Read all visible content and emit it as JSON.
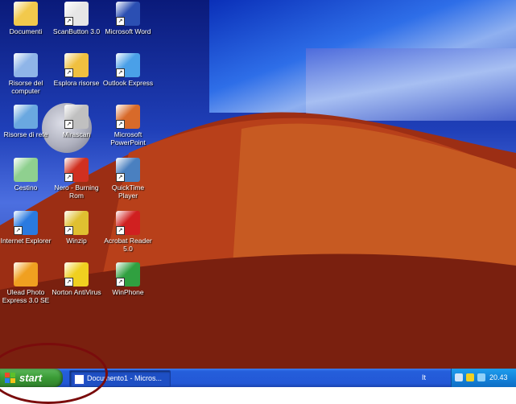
{
  "desktop": {
    "icons": [
      {
        "label": "Documenti",
        "icon": "folder-documents-icon",
        "color": "#f2c94c"
      },
      {
        "label": "ScanButton 3.0",
        "icon": "scanner-icon",
        "color": "#e6e6e6"
      },
      {
        "label": "Microsoft Word",
        "icon": "word-icon",
        "color": "#2b4fb3"
      },
      {
        "label": "Risorse del computer",
        "icon": "computer-icon",
        "color": "#8fb5e8"
      },
      {
        "label": "Esplora risorse",
        "icon": "explorer-icon",
        "color": "#f0c040"
      },
      {
        "label": "Outlook Express",
        "icon": "outlook-express-icon",
        "color": "#4aa0e8"
      },
      {
        "label": "Risorse di rete",
        "icon": "network-icon",
        "color": "#6aa8e0"
      },
      {
        "label": "Mirascan",
        "icon": "mirascan-icon",
        "color": "#c0c0c0"
      },
      {
        "label": "Microsoft PowerPoint",
        "icon": "powerpoint-icon",
        "color": "#d86a2a"
      },
      {
        "label": "Cestino",
        "icon": "recycle-bin-icon",
        "color": "#8fd08f"
      },
      {
        "label": "Nero - Burning Rom",
        "icon": "nero-icon",
        "color": "#d03020"
      },
      {
        "label": "QuickTime Player",
        "icon": "quicktime-icon",
        "color": "#4a80c0"
      },
      {
        "label": "Internet Explorer",
        "icon": "internet-explorer-icon",
        "color": "#2a7ae0"
      },
      {
        "label": "Winzip",
        "icon": "winzip-icon",
        "color": "#e0c030"
      },
      {
        "label": "Acrobat Reader 5.0",
        "icon": "acrobat-icon",
        "color": "#d02020"
      },
      {
        "label": "Ulead Photo Express 3.0 SE",
        "icon": "ulead-icon",
        "color": "#f0a020"
      },
      {
        "label": "Norton AntiVirus",
        "icon": "norton-icon",
        "color": "#f0d020"
      },
      {
        "label": "WinPhone",
        "icon": "winphone-icon",
        "color": "#30a040"
      }
    ]
  },
  "taskbar": {
    "start_label": "start",
    "task_label": "Documento1 - Micros...",
    "tray_text": "It",
    "clock": "20.43",
    "colors": {
      "taskbar": "#245edb",
      "start": "#3a9b35",
      "tray": "#127fd7"
    }
  }
}
